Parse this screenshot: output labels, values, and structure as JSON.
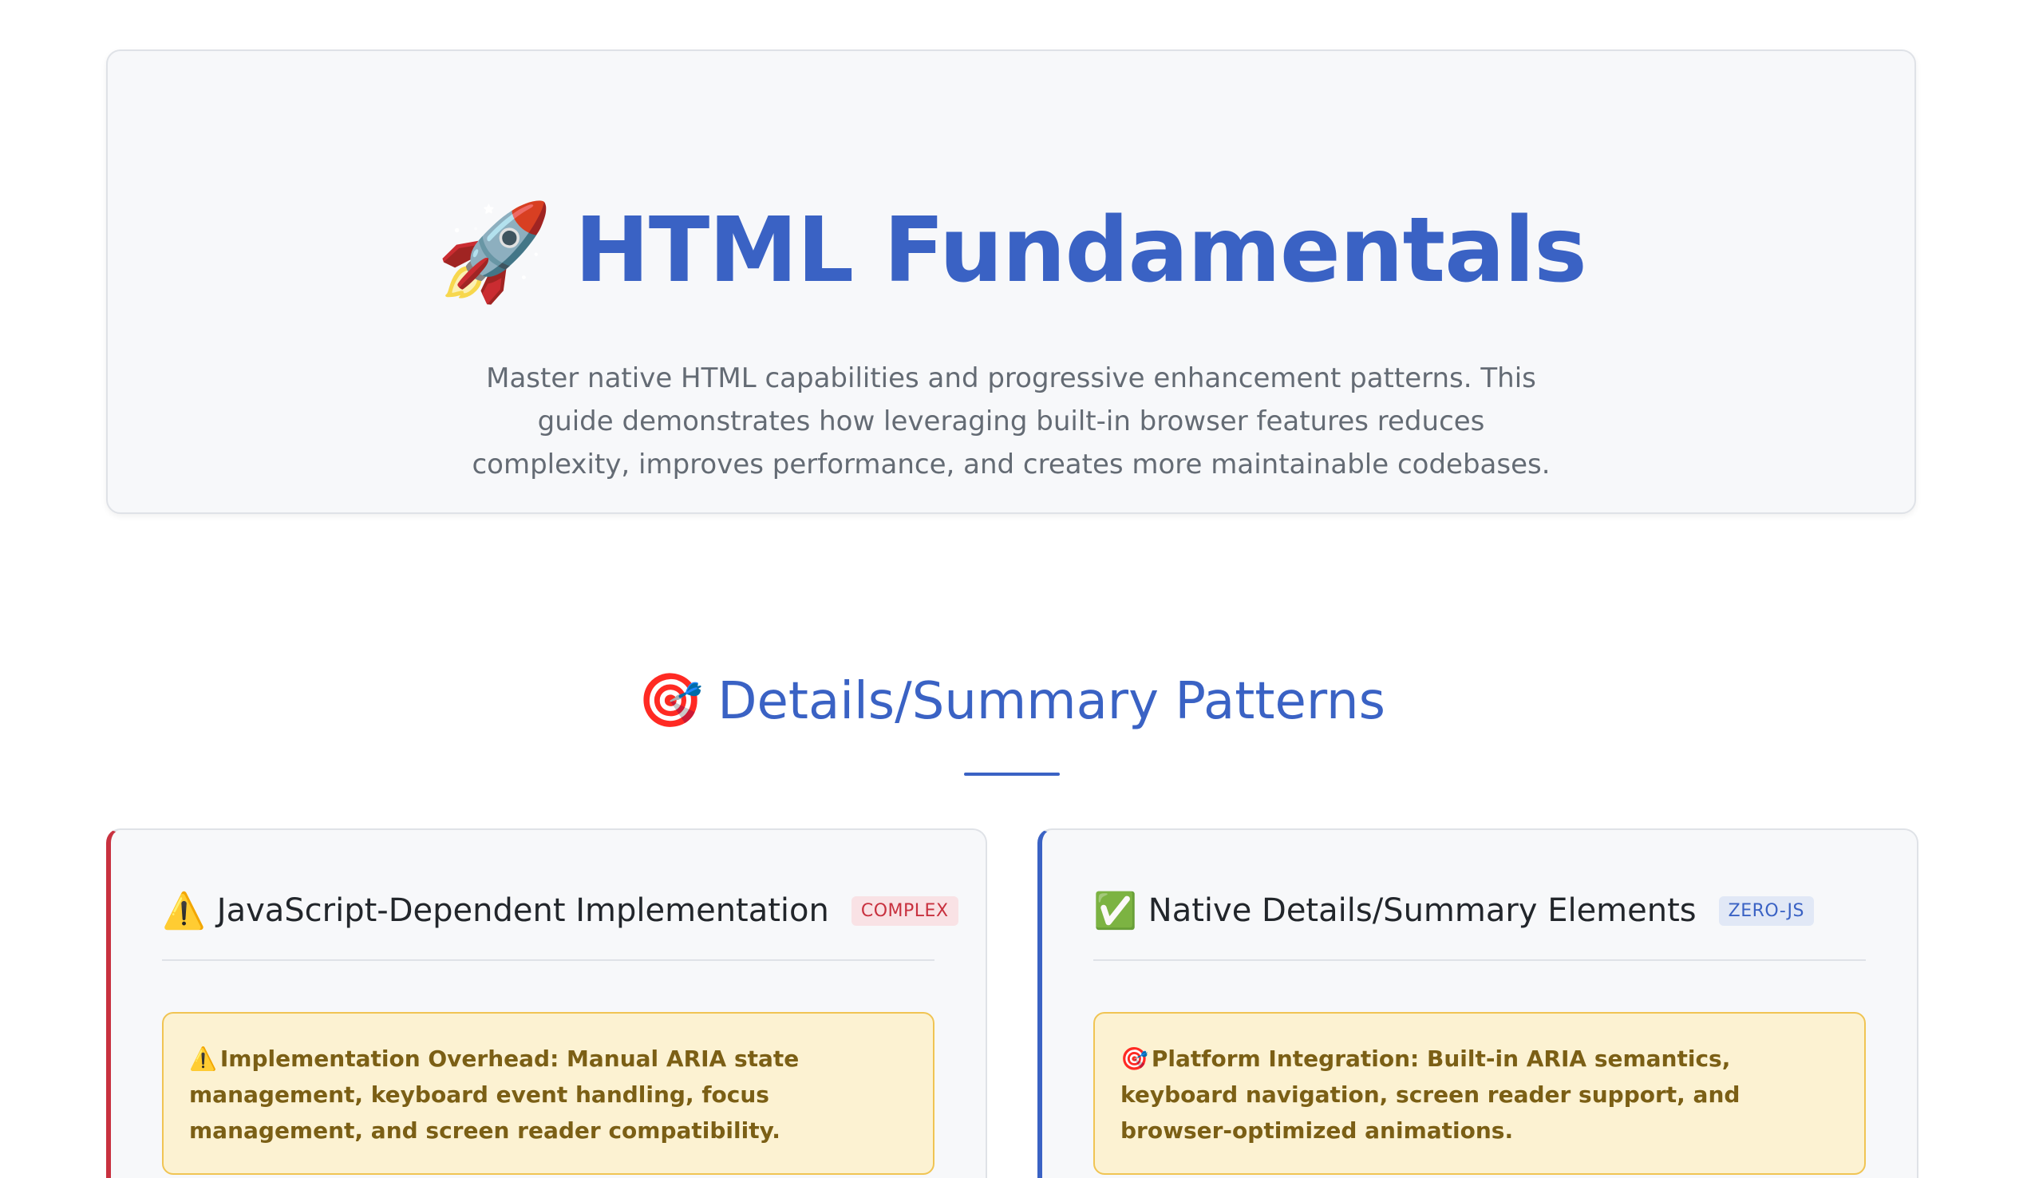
{
  "hero": {
    "icon": "rocket-icon",
    "title": "HTML Fundamentals",
    "description": "Master native HTML capabilities and progressive enhancement patterns. This guide demonstrates how leveraging built-in browser features reduces complexity, improves performance, and creates more maintainable codebases."
  },
  "section": {
    "icon": "target-icon",
    "title": "Details/Summary Patterns"
  },
  "cards": [
    {
      "icon": "warning-icon",
      "title": "JavaScript-Dependent Implementation",
      "badge": "COMPLEX",
      "accent_color": "#c8313f",
      "callout": {
        "icon": "warning-icon",
        "text": "Implementation Overhead: Manual ARIA state management, keyboard event handling, focus management, and screen reader compatibility."
      }
    },
    {
      "icon": "check-icon",
      "title": "Native Details/Summary Elements",
      "badge": "ZERO-JS",
      "accent_color": "#3a62c4",
      "callout": {
        "icon": "target-icon",
        "text": "Platform Integration: Built-in ARIA semantics, keyboard navigation, screen reader support, and browser-optimized animations."
      }
    }
  ],
  "colors": {
    "primary": "#3a62c4",
    "danger": "#c8313f",
    "callout_bg": "#fcf2d2",
    "callout_border": "#f0c453"
  }
}
